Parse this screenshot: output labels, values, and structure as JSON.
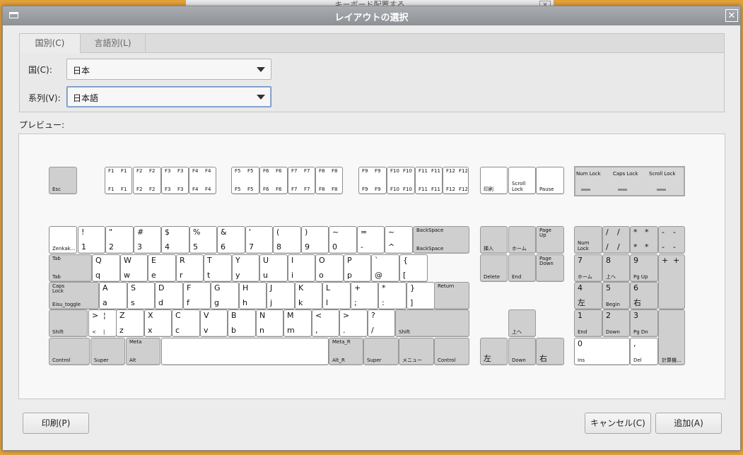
{
  "background_window": {
    "title": "キーボード配置する"
  },
  "dialog": {
    "title": "レイアウトの選択",
    "tabs": [
      {
        "label": "国別(C)"
      },
      {
        "label": "言語別(L)"
      }
    ],
    "country_label": "国(C):",
    "country_value": "日本",
    "variant_label": "系列(V):",
    "variant_value": "日本語",
    "preview_label": "プレビュー:",
    "buttons": {
      "print": "印刷(P)",
      "cancel": "キャンセル(C)",
      "add": "追加(A)"
    }
  },
  "leds": [
    {
      "label": "Num\nLock"
    },
    {
      "label": "Caps\nLock"
    },
    {
      "label": "Scroll\nLock"
    }
  ],
  "keys": [
    {
      "t": "",
      "b": "Esc",
      "fs": 7,
      "gray": true
    },
    {
      "t": "F1",
      "t2": "F1",
      "b": "F1",
      "b2": "F1",
      "fs": 7
    },
    {
      "t": "F2",
      "t2": "F2",
      "b": "F2",
      "b2": "F2",
      "fs": 7
    },
    {
      "t": "F3",
      "t2": "F3",
      "b": "F3",
      "b2": "F3",
      "fs": 7
    },
    {
      "t": "F4",
      "t2": "F4",
      "b": "F4",
      "b2": "F4",
      "fs": 7
    },
    {
      "t": "F5",
      "t2": "F5",
      "b": "F5",
      "b2": "F5",
      "fs": 7
    },
    {
      "t": "F6",
      "t2": "F6",
      "b": "F6",
      "b2": "F6",
      "fs": 7
    },
    {
      "t": "F7",
      "t2": "F7",
      "b": "F7",
      "b2": "F7",
      "fs": 7
    },
    {
      "t": "F8",
      "t2": "F8",
      "b": "F8",
      "b2": "F8",
      "fs": 7
    },
    {
      "t": "F9",
      "t2": "F9",
      "b": "F9",
      "b2": "F9",
      "fs": 7
    },
    {
      "t": "F10",
      "t2": "F10",
      "b": "F10",
      "b2": "F10",
      "fs": 7
    },
    {
      "t": "F11",
      "t2": "F11",
      "b": "F11",
      "b2": "F11",
      "fs": 7
    },
    {
      "t": "F12",
      "t2": "F12",
      "b": "F12",
      "b2": "F12",
      "fs": 7
    },
    {
      "t": "",
      "b": "印刷",
      "fs": 7
    },
    {
      "t": "",
      "b": "Scroll\nLock",
      "fs": 7
    },
    {
      "t": "",
      "b": "Pause",
      "fs": 7
    },
    {
      "t": "",
      "b": "Zenkak...",
      "fs": 7
    },
    {
      "t": "!",
      "b": "1",
      "fs": 11
    },
    {
      "t": "\"",
      "b": "2",
      "fs": 11
    },
    {
      "t": "#",
      "b": "3",
      "fs": 11
    },
    {
      "t": "$",
      "b": "4",
      "fs": 11
    },
    {
      "t": "%",
      "b": "5",
      "fs": 11
    },
    {
      "t": "&",
      "b": "6",
      "fs": 11
    },
    {
      "t": "'",
      "b": "7",
      "fs": 11
    },
    {
      "t": "(",
      "b": "8",
      "fs": 11
    },
    {
      "t": ")",
      "b": "9",
      "fs": 11
    },
    {
      "t": "~",
      "b": "0",
      "fs": 11
    },
    {
      "t": "=",
      "b": "-",
      "fs": 11
    },
    {
      "t": "~",
      "b": "^",
      "fs": 11
    },
    {
      "t": "BackSpace",
      "b": "BackSpace",
      "fs": 7,
      "gray": true
    },
    {
      "t": "",
      "b": "挿入",
      "fs": 7,
      "gray": true
    },
    {
      "t": "",
      "b": "ホーム",
      "fs": 7,
      "gray": true
    },
    {
      "t": "Page\nUp",
      "b": "",
      "fs": 7,
      "gray": true
    },
    {
      "t": "",
      "b": "Num\nLock",
      "fs": 7,
      "gray": true
    },
    {
      "t": "/",
      "t2": "/",
      "b": "/",
      "b2": "/",
      "fs": 11,
      "gray": true
    },
    {
      "t": "*",
      "t2": "*",
      "b": "*",
      "b2": "*",
      "fs": 11,
      "gray": true
    },
    {
      "t": "-",
      "t2": "-",
      "b": "-",
      "b2": "-",
      "fs": 11,
      "gray": true
    },
    {
      "t": "Tab",
      "b": "Tab",
      "fs": 7,
      "gray": true
    },
    {
      "t": "Q",
      "b": "q",
      "fs": 11
    },
    {
      "t": "W",
      "b": "w",
      "fs": 11
    },
    {
      "t": "E",
      "b": "e",
      "fs": 11
    },
    {
      "t": "R",
      "b": "r",
      "fs": 11
    },
    {
      "t": "T",
      "b": "t",
      "fs": 11
    },
    {
      "t": "Y",
      "b": "y",
      "fs": 11
    },
    {
      "t": "U",
      "b": "u",
      "fs": 11
    },
    {
      "t": "I",
      "b": "i",
      "fs": 11
    },
    {
      "t": "O",
      "b": "o",
      "fs": 11
    },
    {
      "t": "P",
      "b": "p",
      "fs": 11
    },
    {
      "t": "`",
      "b": "@",
      "fs": 11
    },
    {
      "t": "{",
      "b": "[",
      "fs": 11
    },
    {
      "t": "",
      "b": "Delete",
      "fs": 7,
      "gray": true
    },
    {
      "t": "",
      "b": "End",
      "fs": 7,
      "gray": true
    },
    {
      "t": "Page\nDown",
      "b": "",
      "fs": 7,
      "gray": true
    },
    {
      "t": "7",
      "b": "ホーム",
      "fs": 11,
      "fsb": 7,
      "gray": true
    },
    {
      "t": "8",
      "b": "上へ",
      "fs": 11,
      "fsb": 7,
      "gray": true
    },
    {
      "t": "9",
      "b": "Pg Up",
      "fs": 11,
      "fsb": 7,
      "gray": true
    },
    {
      "t": "+",
      "t2": "+",
      "b": "",
      "fs": 11,
      "gray": true
    },
    {
      "t": "Caps\nLock",
      "b": "Eisu_toggle",
      "fs": 7,
      "gray": true
    },
    {
      "t": "A",
      "b": "a",
      "fs": 11
    },
    {
      "t": "S",
      "b": "s",
      "fs": 11
    },
    {
      "t": "D",
      "b": "d",
      "fs": 11
    },
    {
      "t": "F",
      "b": "f",
      "fs": 11
    },
    {
      "t": "G",
      "b": "g",
      "fs": 11
    },
    {
      "t": "H",
      "b": "h",
      "fs": 11
    },
    {
      "t": "J",
      "b": "j",
      "fs": 11
    },
    {
      "t": "K",
      "b": "k",
      "fs": 11
    },
    {
      "t": "L",
      "b": "l",
      "fs": 11
    },
    {
      "t": "+",
      "b": ";",
      "fs": 11
    },
    {
      "t": "*",
      "b": ":",
      "fs": 11
    },
    {
      "t": "}",
      "b": "]",
      "fs": 11
    },
    {
      "t": "Return",
      "b": "",
      "fs": 7,
      "gray": true
    },
    {
      "t": "4",
      "b": "左",
      "fs": 11,
      "gray": true
    },
    {
      "t": "5",
      "b": "Begin",
      "fs": 11,
      "fsb": 7,
      "gray": true
    },
    {
      "t": "6",
      "b": "右",
      "fs": 11,
      "gray": true
    },
    {
      "t": "",
      "b": "Shift",
      "fs": 7,
      "gray": true
    },
    {
      "t": ">",
      "t2": "¦",
      "b": "<",
      "b2": "|",
      "fs": 11,
      "fsb": 7
    },
    {
      "t": "Z",
      "b": "z",
      "fs": 11
    },
    {
      "t": "X",
      "b": "x",
      "fs": 11
    },
    {
      "t": "C",
      "b": "c",
      "fs": 11
    },
    {
      "t": "V",
      "b": "v",
      "fs": 11
    },
    {
      "t": "B",
      "b": "b",
      "fs": 11
    },
    {
      "t": "N",
      "b": "n",
      "fs": 11
    },
    {
      "t": "M",
      "b": "m",
      "fs": 11
    },
    {
      "t": "<",
      "b": ",",
      "fs": 11
    },
    {
      "t": ">",
      "b": ".",
      "fs": 11
    },
    {
      "t": "?",
      "b": "/",
      "fs": 11
    },
    {
      "t": "",
      "b": "Shift",
      "fs": 7,
      "gray": true
    },
    {
      "t": "",
      "b": "上へ",
      "fs": 7,
      "gray": true
    },
    {
      "t": "1",
      "b": "End",
      "fs": 11,
      "fsb": 7,
      "gray": true
    },
    {
      "t": "2",
      "b": "Down",
      "fs": 11,
      "fsb": 7,
      "gray": true
    },
    {
      "t": "3",
      "b": "Pg Dn",
      "fs": 11,
      "fsb": 7,
      "gray": true
    },
    {
      "t": "",
      "b": "計算機...",
      "fs": 7,
      "gray": true
    },
    {
      "t": "",
      "b": "Control",
      "fs": 7,
      "gray": true
    },
    {
      "t": "",
      "b": "Super",
      "fs": 7,
      "gray": true
    },
    {
      "t": "Meta",
      "b": "Alt",
      "fs": 7,
      "gray": true
    },
    {
      "t": "",
      "b": "",
      "fs": 7
    },
    {
      "t": "Meta_R",
      "b": "Alt_R",
      "fs": 7,
      "gray": true
    },
    {
      "t": "",
      "b": "Super",
      "fs": 7,
      "gray": true
    },
    {
      "t": "",
      "b": "メニュー",
      "fs": 7,
      "gray": true
    },
    {
      "t": "",
      "b": "Control",
      "fs": 7,
      "gray": true
    },
    {
      "t": "",
      "b": "左",
      "fs": 11,
      "gray": true
    },
    {
      "t": "",
      "b": "Down",
      "fs": 7,
      "gray": true
    },
    {
      "t": "",
      "b": "右",
      "fs": 11,
      "gray": true
    },
    {
      "t": "0",
      "b": "Ins",
      "fs": 11,
      "fsb": 7
    },
    {
      "t": ",",
      "b": "Del",
      "fs": 11,
      "fsb": 7
    }
  ]
}
